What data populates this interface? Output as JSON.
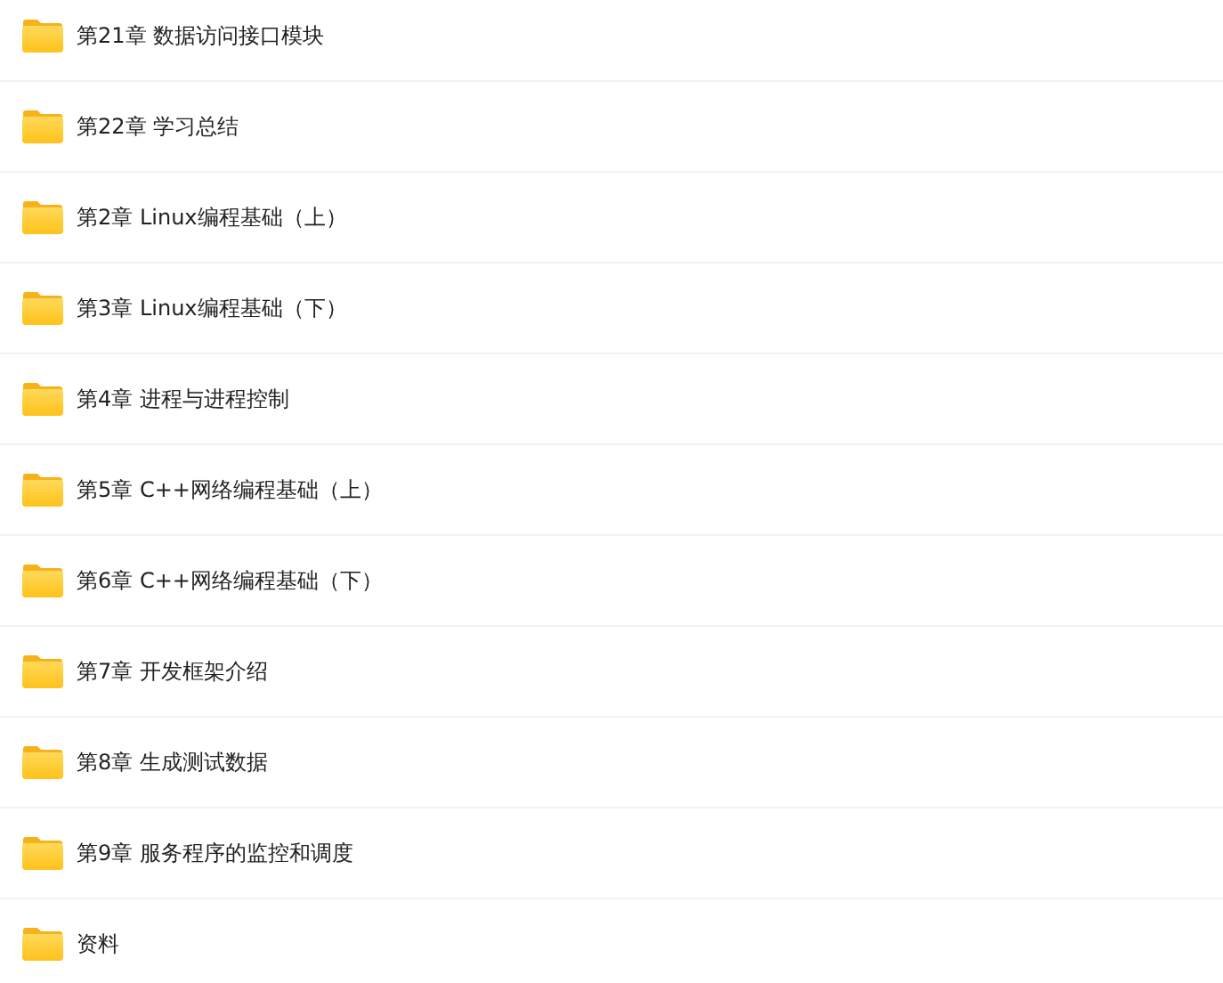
{
  "folders": [
    {
      "name": "第21章 数据访问接口模块"
    },
    {
      "name": "第22章 学习总结"
    },
    {
      "name": "第2章 Linux编程基础（上）"
    },
    {
      "name": "第3章 Linux编程基础（下）"
    },
    {
      "name": "第4章 进程与进程控制"
    },
    {
      "name": "第5章 C++网络编程基础（上）"
    },
    {
      "name": "第6章 C++网络编程基础（下）"
    },
    {
      "name": "第7章 开发框架介绍"
    },
    {
      "name": "第8章 生成测试数据"
    },
    {
      "name": "第9章 服务程序的监控和调度"
    },
    {
      "name": "资料"
    }
  ]
}
